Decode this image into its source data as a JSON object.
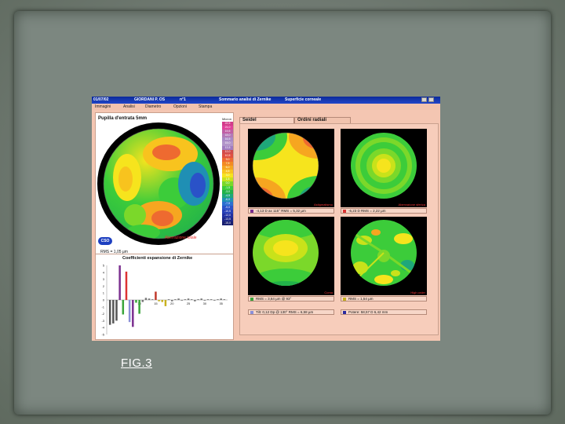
{
  "caption": "FIG.3",
  "window": {
    "date": "01/07/02",
    "patient": "GIORDANI P. OS",
    "number": "n°1",
    "title": "Sommario analisi di Zernike",
    "surface": "Superficie corneale"
  },
  "menu": [
    "Immagini",
    "Analisi",
    "Diametro",
    "Opzioni",
    "Stampa"
  ],
  "left_map": {
    "title": "Pupilla d'entrata 5mm",
    "unit": "Micron",
    "label": "Aberrazione totale",
    "rms": "RMS = 1,05 µm",
    "logo": "CSO",
    "scale": [
      {
        "v": "22,5",
        "c": "#d33a8a"
      },
      {
        "v": "21,0",
        "c": "#e0429a"
      },
      {
        "v": "19,5",
        "c": "#c05fa5"
      },
      {
        "v": "18,0",
        "c": "#b37ab8"
      },
      {
        "v": "16,5",
        "c": "#a98ac6"
      },
      {
        "v": "15,0",
        "c": "#b295c9"
      },
      {
        "v": "13,5",
        "c": "#a07bc0"
      },
      {
        "v": "12,0",
        "c": "#d24b4b"
      },
      {
        "v": "10,5",
        "c": "#e05040"
      },
      {
        "v": "9,0",
        "c": "#ee6a30"
      },
      {
        "v": "7,5",
        "c": "#f38a22"
      },
      {
        "v": "6,0",
        "c": "#f6a620"
      },
      {
        "v": "4,5",
        "c": "#f8c31e"
      },
      {
        "v": "3,0",
        "c": "#f6e41d"
      },
      {
        "v": "1,5",
        "c": "#c9e21a"
      },
      {
        "v": "0,0",
        "c": "#7bd82a"
      },
      {
        "v": "-1,5",
        "c": "#3ccc3a"
      },
      {
        "v": "-3,0",
        "c": "#22b24a"
      },
      {
        "v": "-4,5",
        "c": "#1ea77a"
      },
      {
        "v": "-6,0",
        "c": "#1f8fb4"
      },
      {
        "v": "-7,5",
        "c": "#2a6fd0"
      },
      {
        "v": "-9,0",
        "c": "#2a52c8"
      },
      {
        "v": "-10,5",
        "c": "#273fb6"
      },
      {
        "v": "-12,0",
        "c": "#2230a0"
      },
      {
        "v": "-13,5",
        "c": "#1d2788"
      },
      {
        "v": "-15,0",
        "c": "#181f70"
      }
    ]
  },
  "tabs": [
    "Seidel",
    "Ordini radiali"
  ],
  "maps": [
    {
      "label": "Astigmatismo",
      "legend": "-4,13 D ax 115° RMS = 5,32 µm",
      "legend_color": "#7b2f8f"
    },
    {
      "label": "Aberrazione sferica",
      "legend": "-6,23 D RMS = 2,22 µm",
      "legend_color": "#d33"
    },
    {
      "label": "Coma",
      "legend": "RMS = 3,64 µm @ 93°",
      "legend_color": "#3aa43a"
    },
    {
      "label": "High order",
      "legend": "RMS = 1,54 µm",
      "legend_color": "#c8b11e"
    }
  ],
  "extra_legends": [
    {
      "text": "Tilt: 0,12 Dp @ 130° RMS = 6,58 µm",
      "color": "#8a8fd8"
    },
    {
      "text": "Potere: 58,57 D 6,42 mm",
      "color": "#2a2aa0"
    }
  ],
  "chart": {
    "title": "Coefficienti espansione di Zernike",
    "yticks": [
      "5",
      "4",
      "3",
      "2",
      "1",
      "0",
      "-1",
      "-2",
      "-3",
      "-4",
      "-5"
    ],
    "xticks": [
      "5",
      "10",
      "15",
      "20",
      "25",
      "30",
      "35"
    ]
  },
  "chart_data": {
    "type": "bar",
    "title": "Coefficienti espansione di Zernike",
    "x": [
      1,
      2,
      3,
      4,
      5,
      6,
      7,
      8,
      9,
      10,
      11,
      12,
      13,
      14,
      15,
      16,
      17,
      18,
      19,
      20,
      21,
      22,
      23,
      24,
      25,
      26,
      27,
      28,
      29,
      30,
      31,
      32,
      33,
      34,
      35,
      36
    ],
    "values": [
      -3.6,
      -3.4,
      -3.0,
      5.0,
      -2.1,
      4.1,
      -3.2,
      -3.9,
      -0.4,
      -2.0,
      -0.3,
      0.3,
      0.2,
      0.1,
      1.2,
      -0.2,
      -0.3,
      -0.9,
      0.1,
      -0.2,
      0.1,
      0.2,
      -0.1,
      0.1,
      0.2,
      0.1,
      -0.2,
      0.1,
      0.2,
      -0.1,
      0.1,
      0.1,
      -0.1,
      0.1,
      0.2,
      0.1
    ],
    "colors": [
      "#555",
      "#555",
      "#555",
      "#7b2f8f",
      "#3aa43a",
      "#d33",
      "#8a8fd8",
      "#7b2f8f",
      "#3aa43a",
      "#3aa43a",
      "#777",
      "#777",
      "#777",
      "#777",
      "#c0392b",
      "#c8b11e",
      "#c8b11e",
      "#c8b11e",
      "#777",
      "#777",
      "#777",
      "#777",
      "#777",
      "#777",
      "#777",
      "#777",
      "#777",
      "#777",
      "#777",
      "#777",
      "#777",
      "#777",
      "#777",
      "#777",
      "#777",
      "#777"
    ],
    "ylim": [
      -5,
      5
    ],
    "xlim": [
      0,
      37
    ]
  }
}
